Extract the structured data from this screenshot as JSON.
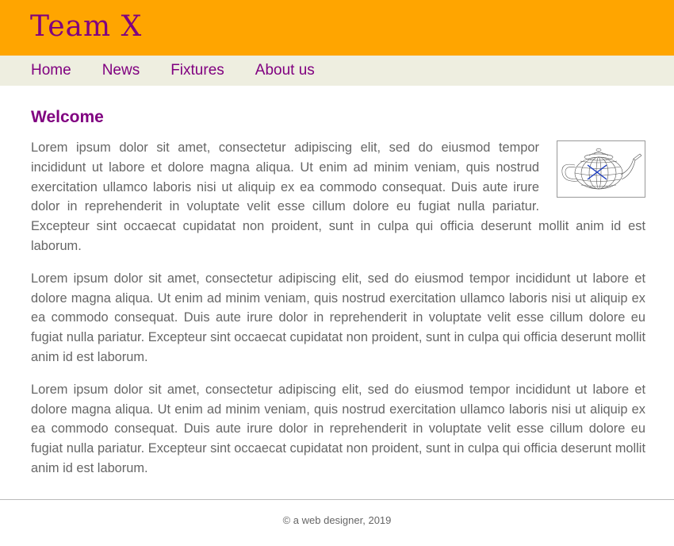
{
  "header": {
    "logo": "Team X"
  },
  "nav": {
    "items": [
      {
        "label": "Home"
      },
      {
        "label": "News"
      },
      {
        "label": "Fixtures"
      },
      {
        "label": "About us"
      }
    ]
  },
  "main": {
    "title": "Welcome",
    "paragraphs": [
      "Lorem ipsum dolor sit amet, consectetur adipiscing elit, sed do eiusmod tempor incididunt ut labore et dolore magna aliqua. Ut enim ad minim veniam, quis nostrud exercitation ullamco laboris nisi ut aliquip ex ea commodo consequat. Duis aute irure dolor in reprehenderit in voluptate velit esse cillum dolore eu fugiat nulla pariatur. Excepteur sint occaecat cupidatat non proident, sunt in culpa qui officia deserunt mollit anim id est laborum.",
      "Lorem ipsum dolor sit amet, consectetur adipiscing elit, sed do eiusmod tempor incididunt ut labore et dolore magna aliqua. Ut enim ad minim veniam, quis nostrud exercitation ullamco laboris nisi ut aliquip ex ea commodo consequat. Duis aute irure dolor in reprehenderit in voluptate velit esse cillum dolore eu fugiat nulla pariatur. Excepteur sint occaecat cupidatat non proident, sunt in culpa qui officia deserunt mollit anim id est laborum.",
      "Lorem ipsum dolor sit amet, consectetur adipiscing elit, sed do eiusmod tempor incididunt ut labore et dolore magna aliqua. Ut enim ad minim veniam, quis nostrud exercitation ullamco laboris nisi ut aliquip ex ea commodo consequat. Duis aute irure dolor in reprehenderit in voluptate velit esse cillum dolore eu fugiat nulla pariatur. Excepteur sint occaecat cupidatat non proident, sunt in culpa qui officia deserunt mollit anim id est laborum."
    ],
    "image": {
      "icon": "teapot-wireframe-image"
    }
  },
  "footer": {
    "text": "© a web designer, 2019"
  },
  "colors": {
    "header_bg": "#ffa500",
    "nav_bg": "#eeeee0",
    "accent": "#800080",
    "body_text": "#666666"
  }
}
